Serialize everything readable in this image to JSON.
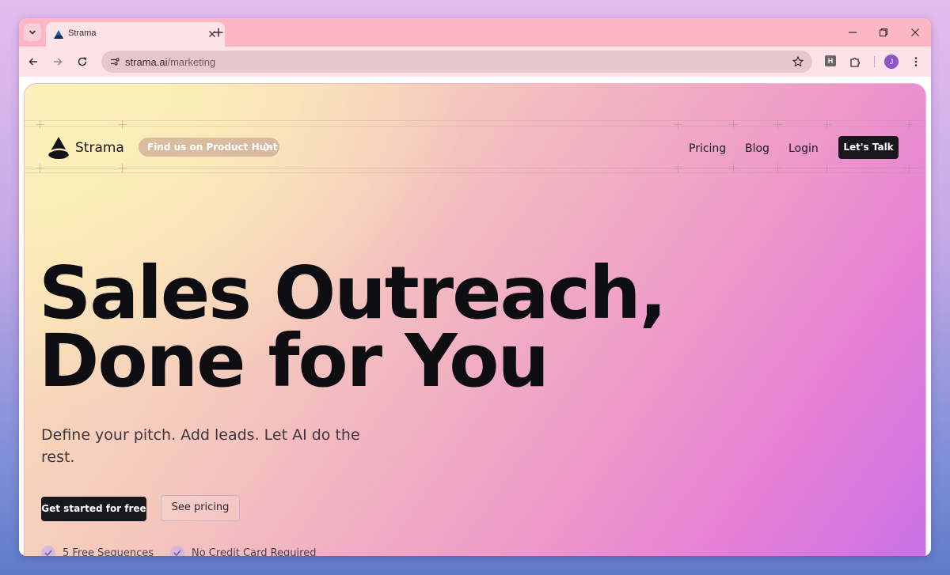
{
  "browser": {
    "tab": {
      "title": "Strama"
    },
    "url": {
      "domain": "strama.ai",
      "path": "/marketing"
    },
    "extension_letter": "H",
    "profile_initial": "J"
  },
  "nav": {
    "brand": "Strama",
    "promo": "Find us on Product Hunt",
    "links": [
      "Pricing",
      "Blog",
      "Login"
    ],
    "cta": "Let's Talk"
  },
  "hero": {
    "headline": "Sales Outreach,\nDone for You",
    "subheadline": "Define your pitch. Add leads. Let AI do the rest.",
    "primary_cta": "Get started for free",
    "secondary_cta": "See pricing",
    "features": [
      "5 Free Sequences",
      "No Credit Card Required"
    ]
  },
  "colors": {
    "brand_dark": "#18171c",
    "tab_strip": "#fdb6c4",
    "toolbar": "#fde3e8"
  }
}
